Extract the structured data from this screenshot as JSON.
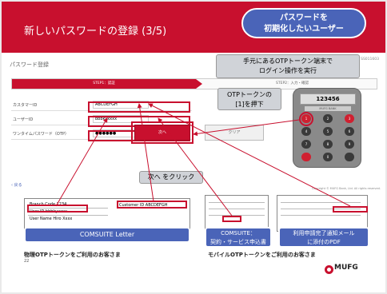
{
  "header": {
    "title": "新しいパスワードの登録 (3/5)",
    "callout": [
      "パスワードを",
      "初期化したいユーザー"
    ]
  },
  "screen": {
    "title": "パスワード登録",
    "code": "SS011603",
    "steps": {
      "step1": "STEP1：認証",
      "step2": "STEP2：入力・確認"
    },
    "fields": [
      {
        "label": "カスタマーID",
        "value": "ABCDEFGH"
      },
      {
        "label": "ユーザーID",
        "value": "bbbkyxxxx"
      },
      {
        "label": "ワンタイムパスワード（OTP）",
        "value": "●●●●●●"
      }
    ],
    "buttons": {
      "next": "次へ",
      "clear": "クリア"
    },
    "back": "戻る",
    "copyright": "Copyright © MUFG Bank, Ltd. All rights reserved."
  },
  "device": {
    "display": "123456",
    "sub_display": "MUFG BANK",
    "keys": [
      "1",
      "2",
      "3",
      "4",
      "5",
      "6",
      "7",
      "8",
      "9",
      "",
      "0",
      ""
    ]
  },
  "callouts": {
    "otp_device": [
      "手元にあるOTPトークン端末で",
      "ログイン操作を実行"
    ],
    "otp_press": [
      "OTPトークンの",
      "[1]を押下"
    ],
    "click_next": "次へ をクリック",
    "letter": "COMSUITE Letter",
    "application": [
      "COMSUITE：",
      "契約・サービス申込書"
    ],
    "pdf": [
      "利用申請完了通知メール",
      "に添付のPDF"
    ]
  },
  "letter_doc": {
    "rows": [
      {
        "label": "Branch Code",
        "value": "1234"
      },
      {
        "label": "User ID",
        "value": "bbbkyxxxx"
      },
      {
        "label": "User Name",
        "value": "Hiro Xxxx"
      }
    ],
    "customer_id_label": "Customer ID",
    "customer_id_value": "ABCDEFGH"
  },
  "footer": {
    "physical": "物理OTPトークンをご利用のお客さま",
    "mobile": "モバイルOTPトークンをご利用のお客さま",
    "page_number": "22",
    "brand": "MUFG"
  },
  "colors": {
    "accent": "#c8102e",
    "callout": "#4a64b8"
  }
}
